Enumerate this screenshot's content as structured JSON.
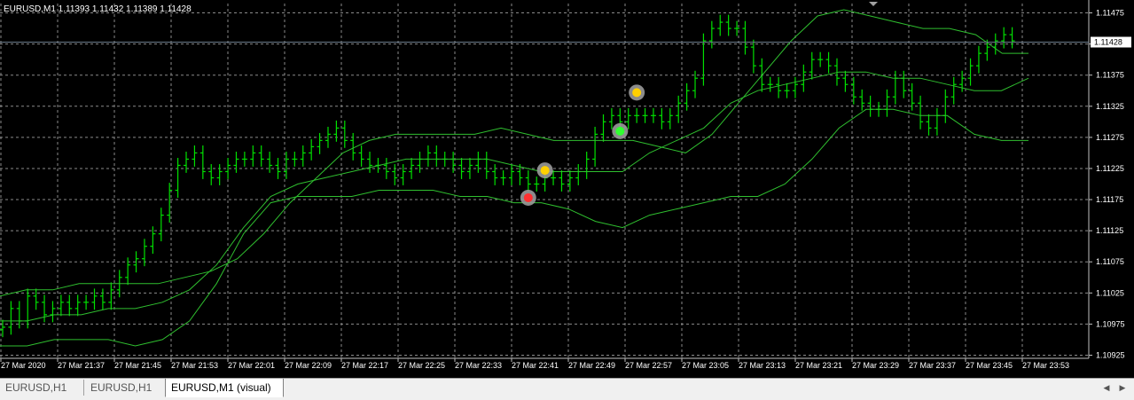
{
  "symbol_info": "EURUSD,M1  1.11393 1.11432 1.11389 1.11428",
  "tabs": [
    {
      "label": "EURUSD,H1",
      "active": false
    },
    {
      "label": "EURUSD,H1",
      "active": false
    },
    {
      "label": "EURUSD,M1 (visual)",
      "active": true
    }
  ],
  "colors": {
    "background": "#000000",
    "grid": "#8a8a8a",
    "candle": "#00e000",
    "bands": "#2fbf2f",
    "axis_text": "#ffffff",
    "price_line": "#6a7a8a",
    "price_box_bg": "#ffffff",
    "price_box_text": "#000000",
    "tab_bg": "#f0f0f0"
  },
  "chart_data": {
    "type": "bar",
    "title": "EURUSD,M1",
    "y_ticks": [
      "1.11475",
      "1.11425",
      "1.11375",
      "1.11325",
      "1.11275",
      "1.11225",
      "1.11175",
      "1.11125",
      "1.11075",
      "1.11025",
      "1.10975",
      "1.10925"
    ],
    "y_tick_values": [
      1.11475,
      1.11425,
      1.11375,
      1.11325,
      1.11275,
      1.11225,
      1.11175,
      1.11125,
      1.11075,
      1.11025,
      1.10975,
      1.10925
    ],
    "ylim": [
      1.1092,
      1.1149
    ],
    "x_ticks": [
      "27 Mar 2020",
      "27 Mar 21:37",
      "27 Mar 21:45",
      "27 Mar 21:53",
      "27 Mar 22:01",
      "27 Mar 22:09",
      "27 Mar 22:17",
      "27 Mar 22:25",
      "27 Mar 22:33",
      "27 Mar 22:41",
      "27 Mar 22:49",
      "27 Mar 22:57",
      "27 Mar 23:05",
      "27 Mar 23:13",
      "27 Mar 23:21",
      "27 Mar 23:29",
      "27 Mar 23:37",
      "27 Mar 23:45",
      "27 Mar 23:53"
    ],
    "current_price": "1.11428",
    "current_price_value": 1.11428,
    "grid": true,
    "close": [
      1.1097,
      1.11,
      1.1098,
      1.1102,
      1.1101,
      1.1099,
      1.11,
      1.1101,
      1.11,
      1.1101,
      1.1101,
      1.1102,
      1.1101,
      1.1103,
      1.1105,
      1.1107,
      1.1108,
      1.111,
      1.1112,
      1.1115,
      1.1119,
      1.1123,
      1.1124,
      1.1125,
      1.1122,
      1.1121,
      1.1122,
      1.1123,
      1.1124,
      1.1124,
      1.1125,
      1.1124,
      1.1123,
      1.1122,
      1.1124,
      1.1124,
      1.1125,
      1.1126,
      1.1127,
      1.1128,
      1.1129,
      1.1127,
      1.1125,
      1.1124,
      1.1123,
      1.1123,
      1.1122,
      1.1121,
      1.1122,
      1.1123,
      1.1124,
      1.1125,
      1.1124,
      1.1124,
      1.1123,
      1.1122,
      1.1123,
      1.1124,
      1.1122,
      1.1121,
      1.1121,
      1.1122,
      1.1121,
      1.112,
      1.112,
      1.1121,
      1.1121,
      1.112,
      1.1121,
      1.1122,
      1.1124,
      1.1128,
      1.113,
      1.1131,
      1.113,
      1.1131,
      1.1131,
      1.1131,
      1.1131,
      1.113,
      1.1131,
      1.1133,
      1.1135,
      1.1137,
      1.1143,
      1.1145,
      1.1146,
      1.1145,
      1.1145,
      1.1142,
      1.1139,
      1.1136,
      1.1136,
      1.1135,
      1.1135,
      1.1136,
      1.1138,
      1.114,
      1.114,
      1.1139,
      1.1137,
      1.1136,
      1.1134,
      1.1133,
      1.1132,
      1.1132,
      1.1134,
      1.1137,
      1.1135,
      1.1133,
      1.113,
      1.1129,
      1.1131,
      1.1134,
      1.1136,
      1.1137,
      1.1139,
      1.1141,
      1.1142,
      1.1143,
      1.1144,
      1.1143
    ],
    "upper_band": [
      1.1102,
      1.1103,
      1.1103,
      1.1104,
      1.1104,
      1.1104,
      1.1104,
      1.1105,
      1.1106,
      1.1108,
      1.1112,
      1.1117,
      1.1121,
      1.1125,
      1.1127,
      1.1128,
      1.1128,
      1.1128,
      1.1128,
      1.1129,
      1.1128,
      1.1127,
      1.1127,
      1.1127,
      1.1127,
      1.1126,
      1.1125,
      1.1128,
      1.1133,
      1.1138,
      1.1143,
      1.1147,
      1.1148,
      1.1147,
      1.1146,
      1.1145,
      1.1145,
      1.1144,
      1.1141,
      1.1141
    ],
    "middle_band": [
      1.1098,
      1.1098,
      1.1099,
      1.1099,
      1.11,
      1.11,
      1.1101,
      1.1103,
      1.1107,
      1.1113,
      1.1118,
      1.112,
      1.1121,
      1.1122,
      1.1123,
      1.1124,
      1.1124,
      1.1124,
      1.1124,
      1.1123,
      1.1122,
      1.1122,
      1.1122,
      1.1122,
      1.1125,
      1.1127,
      1.1129,
      1.1133,
      1.1135,
      1.1136,
      1.1137,
      1.1138,
      1.1138,
      1.1137,
      1.1137,
      1.1136,
      1.1135,
      1.1135,
      1.1137
    ],
    "lower_band": [
      1.1094,
      1.1094,
      1.1095,
      1.1095,
      1.1095,
      1.1094,
      1.1095,
      1.1098,
      1.1104,
      1.1112,
      1.1117,
      1.1118,
      1.1118,
      1.1118,
      1.1119,
      1.1119,
      1.1119,
      1.1118,
      1.1118,
      1.1117,
      1.1117,
      1.1116,
      1.1114,
      1.1113,
      1.1115,
      1.1116,
      1.1117,
      1.1118,
      1.1118,
      1.112,
      1.1124,
      1.1129,
      1.1132,
      1.1132,
      1.1131,
      1.1131,
      1.1128,
      1.1127,
      1.1127
    ],
    "trade_markers": [
      {
        "time_index": 63,
        "price": 1.11178,
        "kind": "sell-entry"
      },
      {
        "time_index": 65,
        "price": 1.11222,
        "kind": "exit"
      },
      {
        "time_index": 74,
        "price": 1.11285,
        "kind": "buy-entry"
      },
      {
        "time_index": 76,
        "price": 1.11347,
        "kind": "exit"
      }
    ]
  }
}
